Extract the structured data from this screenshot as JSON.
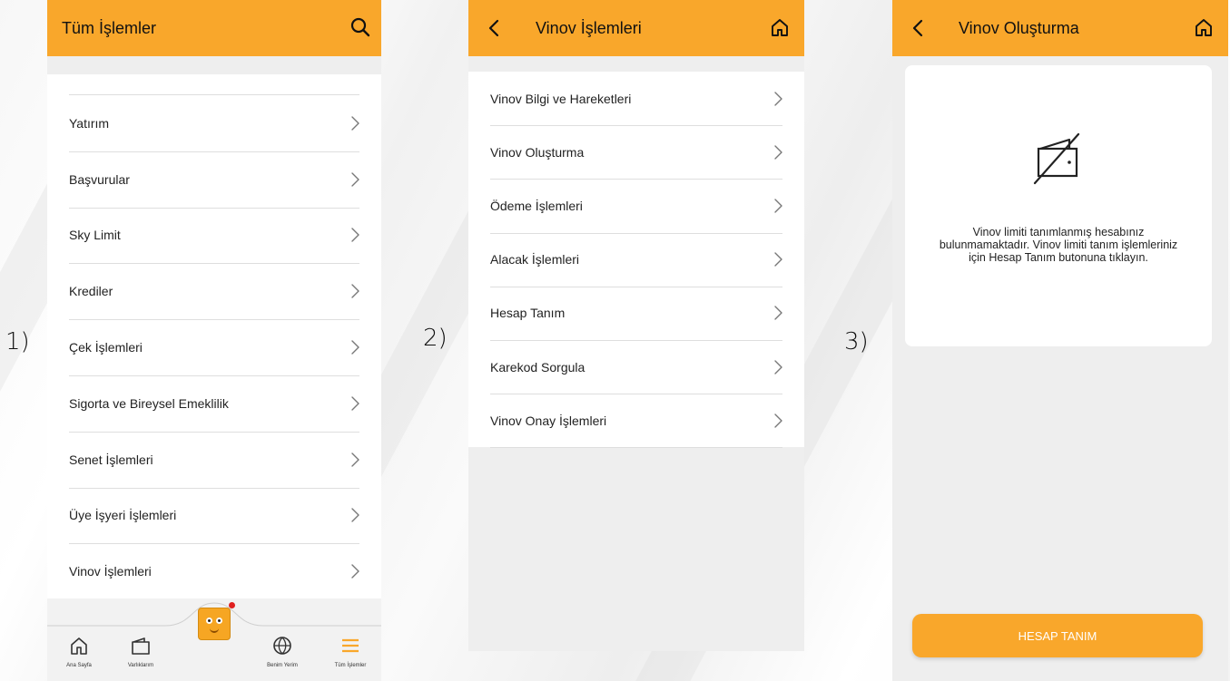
{
  "labels": {
    "one": "1)",
    "two": "2)",
    "three": "3)"
  },
  "screen1": {
    "title": "Tüm İşlemler",
    "items": [
      "Yatırım",
      "Başvurular",
      "Sky Limit",
      "Krediler",
      "Çek İşlemleri",
      "Sigorta ve Bireysel Emeklilik",
      "Senet İşlemleri",
      "Üye İşyeri İşlemleri",
      "Vinov İşlemleri"
    ],
    "nav": [
      {
        "label": "Ana Sayfa",
        "icon": "home-icon"
      },
      {
        "label": "Varlıklarım",
        "icon": "wallet-icon"
      },
      {
        "label": "",
        "icon": "mascot-icon"
      },
      {
        "label": "Benim Yerim",
        "icon": "globe-icon"
      },
      {
        "label": "Tüm İşlemler",
        "icon": "menu-icon"
      }
    ],
    "accent": "#f9a72b",
    "badge_color": "#e02020"
  },
  "screen2": {
    "title": "Vinov İşlemleri",
    "items": [
      "Vinov Bilgi ve Hareketleri",
      "Vinov Oluşturma",
      "Ödeme İşlemleri",
      "Alacak İşlemleri",
      "Hesap Tanım",
      "Karekod Sorgula",
      "Vinov Onay İşlemleri"
    ]
  },
  "screen3": {
    "title": "Vinov Oluşturma",
    "message": "Vinov limiti tanımlanmış hesabınız bulunmamaktadır. Vinov limiti tanım işlemleriniz için Hesap Tanım butonuna tıklayın.",
    "button": "HESAP TANIM",
    "empty_icon": "wallet-off-icon"
  }
}
